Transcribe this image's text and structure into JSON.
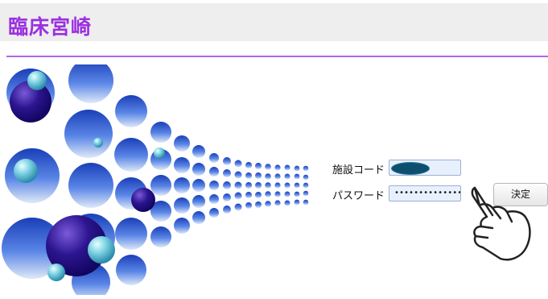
{
  "header": {
    "title": "臨床宮崎"
  },
  "login": {
    "facility_code_label": "施設コード",
    "facility_code_value": "",
    "password_label": "パスワード",
    "password_value": "••••••••••••••",
    "submit_label": "決定"
  },
  "icons": {
    "hero": "bubbles-illustration",
    "pointer": "pointing-hand-icon"
  }
}
